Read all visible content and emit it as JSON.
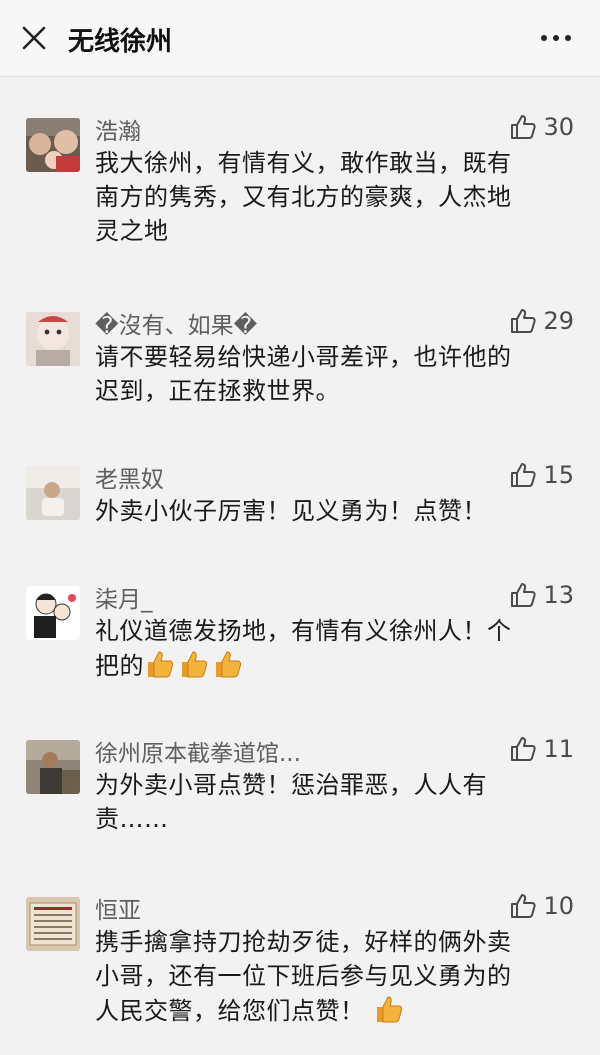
{
  "header": {
    "title": "无线徐州"
  },
  "comments": [
    {
      "nickname": "浩瀚",
      "likes": "30",
      "text": "我大徐州，有情有义，敢作敢当，既有\n南方的隽秀，又有北方的豪爽，人杰地\n灵之地"
    },
    {
      "nickname": "�沒有、如果�",
      "likes": "29",
      "text": "请不要轻易给快递小哥差评，也许他的\n迟到，正在拯救世界。"
    },
    {
      "nickname": "老黑奴",
      "likes": "15",
      "text": "外卖小伙子厉害！见义勇为！点赞！"
    },
    {
      "nickname": "柒月_",
      "likes": "13",
      "text": "礼仪道德发扬地，有情有义徐州人！个\n把的"
    },
    {
      "nickname": "徐州原本截拳道馆...",
      "likes": "11",
      "text": "为外卖小哥点赞！惩治罪恶，人人有\n责……"
    },
    {
      "nickname": "恒亚",
      "likes": "10",
      "text": "携手擒拿持刀抢劫歹徒，好样的俩外卖\n小哥，还有一位下班后参与见义勇为的\n人民交警，给您们点赞！"
    }
  ],
  "icons": {
    "close": "close-icon",
    "more": "more-icon",
    "like": "thumb-up-outline-icon",
    "emoji": "thumbs-up-emoji-icon"
  },
  "colors": {
    "background": "#f2f2f2",
    "like_icon": "#4a4a4a",
    "emoji": "#f0a030"
  }
}
